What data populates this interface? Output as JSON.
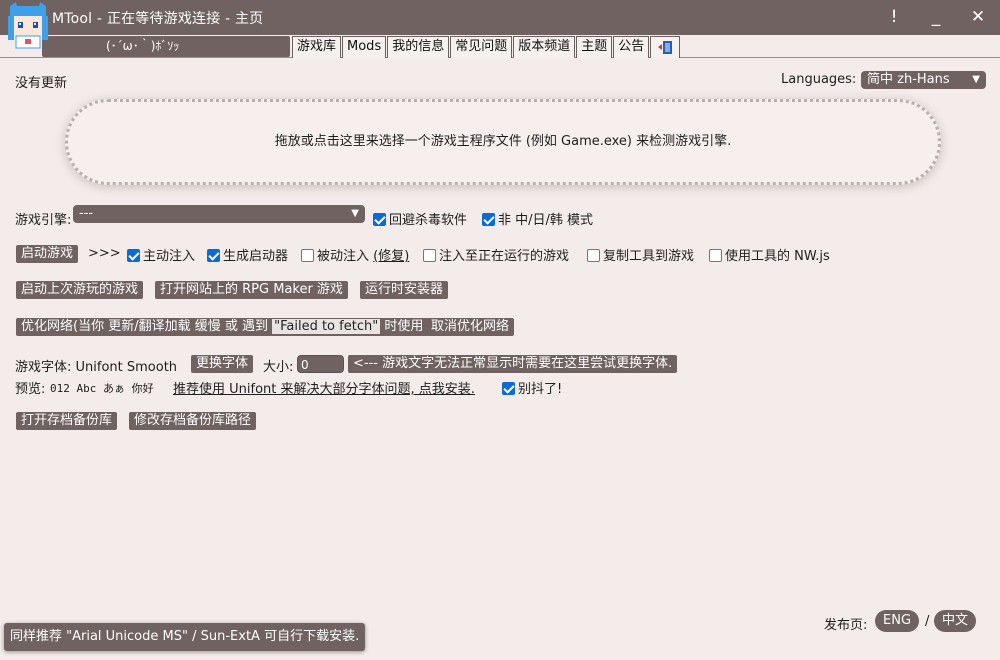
{
  "window": {
    "title": "MTool - 正在等待游戏连接 - 主页",
    "controls": {
      "info": "!",
      "minimize": "_",
      "close": "✕"
    }
  },
  "header": {
    "kaomoji": "(･´ω･｀)ﾎﾞｿｯ",
    "tabs": [
      "游戏库",
      "Mods",
      "我的信息",
      "常见问题",
      "版本频道",
      "主题",
      "公告"
    ]
  },
  "main": {
    "update_status": "没有更新",
    "language": {
      "label": "Languages:",
      "value": "简中 zh-Hans"
    },
    "dropzone_text": "拖放或点击这里来选择一个游戏主程序文件 (例如 Game.exe) 来检测游戏引擎.",
    "engine": {
      "label": "游戏引擎:",
      "value": "---",
      "avoid_av": {
        "label": "回避杀毒软件",
        "checked": true
      },
      "non_cjk": {
        "label": "非 中/日/韩 模式",
        "checked": true
      }
    },
    "launch": {
      "button": "启动游戏",
      "arrows": ">>>",
      "options": [
        {
          "label": "主动注入",
          "checked": true
        },
        {
          "label": "生成启动器",
          "checked": true
        },
        {
          "label": "被动注入",
          "extra": "(修复)",
          "checked": false
        },
        {
          "label": "注入至正在运行的游戏",
          "checked": false
        },
        {
          "label": "复制工具到游戏",
          "checked": false
        },
        {
          "label": "使用工具的 NW.js",
          "checked": false
        }
      ]
    },
    "actions": {
      "launch_last": "启动上次游玩的游戏",
      "open_rpgmaker": "打开网站上的 RPG Maker 游戏",
      "runtime_installer": "运行时安装器"
    },
    "network": {
      "optimize_pre": "优化网络(当你 更新/翻译加载 缓慢 或 遇到",
      "optimize_code": "\"Failed to fetch\"",
      "optimize_post": "时使用",
      "cancel": "取消优化网络"
    },
    "font": {
      "label": "游戏字体: Unifont Smooth",
      "change": "更换字体",
      "size_label": "大小:",
      "size_value": "0",
      "hint": "<--- 游戏文字无法正常显示时需要在这里尝试更换字体.",
      "preview_label": "预览:",
      "preview_text": "012 Abc あぁ 你好",
      "recommend": "推荐使用 Unifont 来解决大部分字体问题, 点我安装.",
      "jitter": {
        "label": "别抖了!",
        "checked": true
      }
    },
    "backup": {
      "open": "打开存档备份库",
      "change_path": "修改存档备份库路径"
    }
  },
  "footer": {
    "toast": "同样推荐 \"Arial Unicode MS\" / Sun-ExtA 可自行下载安装.",
    "release_label": "发布页:",
    "release_eng": "ENG",
    "separator": "/",
    "release_cn": "中文"
  },
  "colors": {
    "titlebar": "#6f6261",
    "background": "#f4ecea",
    "checkbox_accent": "#0a6bd6"
  }
}
